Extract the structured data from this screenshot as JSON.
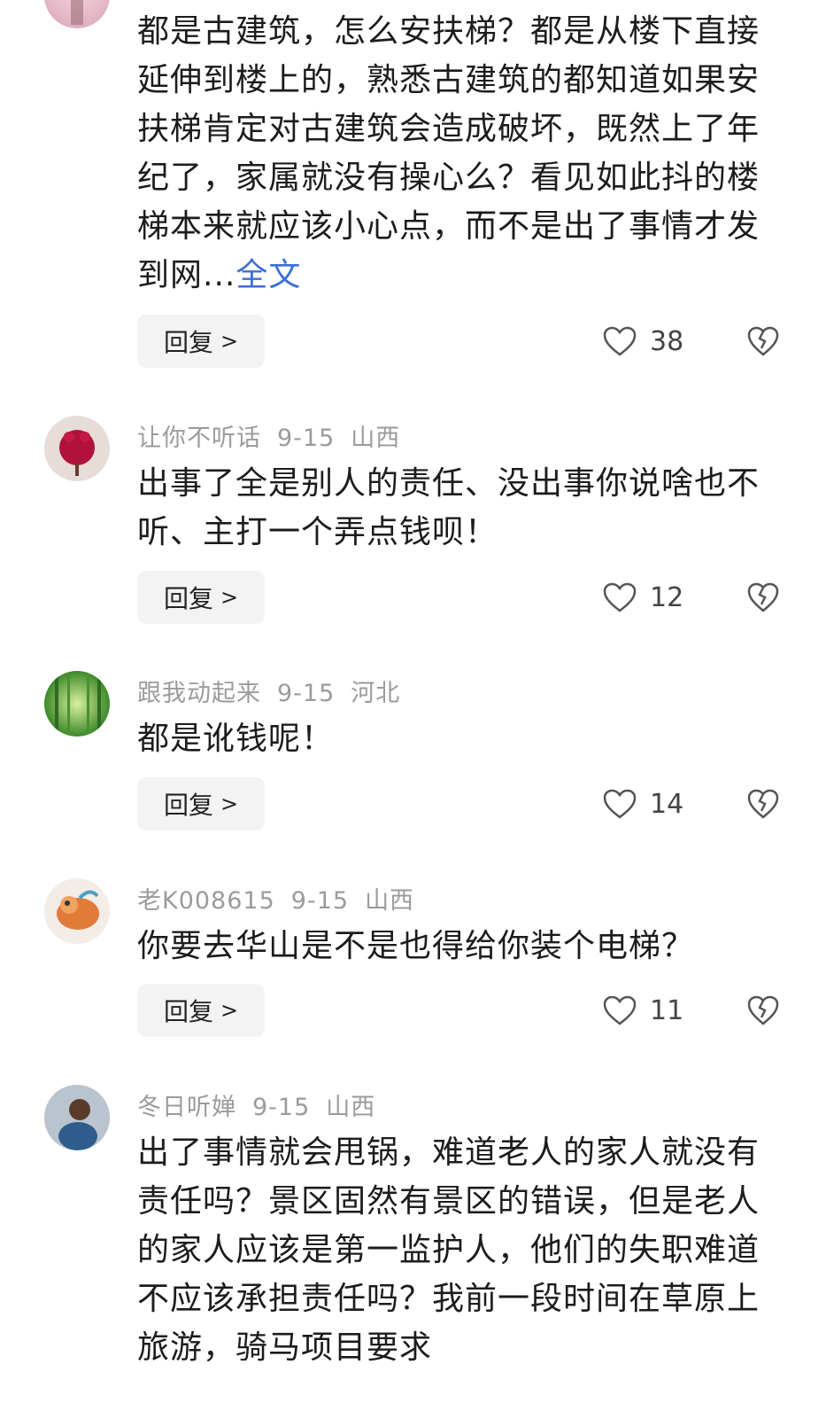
{
  "comments": [
    {
      "user": "",
      "date": "",
      "location": "",
      "text": "都是古建筑，怎么安扶梯？都是从楼下直接延伸到楼上的，熟悉古建筑的都知道如果安扶梯肯定对古建筑会造成破坏，既然上了年纪了，家属就没有操心么？看见如此抖的楼梯本来就应该小心点，而不是出了事情才发到网...",
      "more": "全文",
      "reply": "回复",
      "likes": "38"
    },
    {
      "user": "让你不听话",
      "date": "9-15",
      "location": "山西",
      "text": "出事了全是别人的责任、没出事你说啥也不听、主打一个弄点钱呗！",
      "reply": "回复",
      "likes": "12"
    },
    {
      "user": "跟我动起来",
      "date": "9-15",
      "location": "河北",
      "text": "都是讹钱呢！",
      "reply": "回复",
      "likes": "14"
    },
    {
      "user": "老K008615",
      "date": "9-15",
      "location": "山西",
      "text": "你要去华山是不是也得给你装个电梯？",
      "reply": "回复",
      "likes": "11"
    },
    {
      "user": "冬日听婵",
      "date": "9-15",
      "location": "山西",
      "text": "出了事情就会甩锅，难道老人的家人就没有责任吗？景区固然有景区的错误，但是老人的家人应该是第一监护人，他们的失职难道不应该承担责任吗？我前一段时间在草原上旅游，骑马项目要求"
    }
  ],
  "icons": {
    "like": "heart-outline-icon",
    "dislike": "broken-heart-icon",
    "reply_chevron": "chevron-right-icon"
  },
  "colors": {
    "link": "#3b6fd6",
    "meta": "#9b9b9b",
    "reply_bg": "#f3f3f3"
  }
}
